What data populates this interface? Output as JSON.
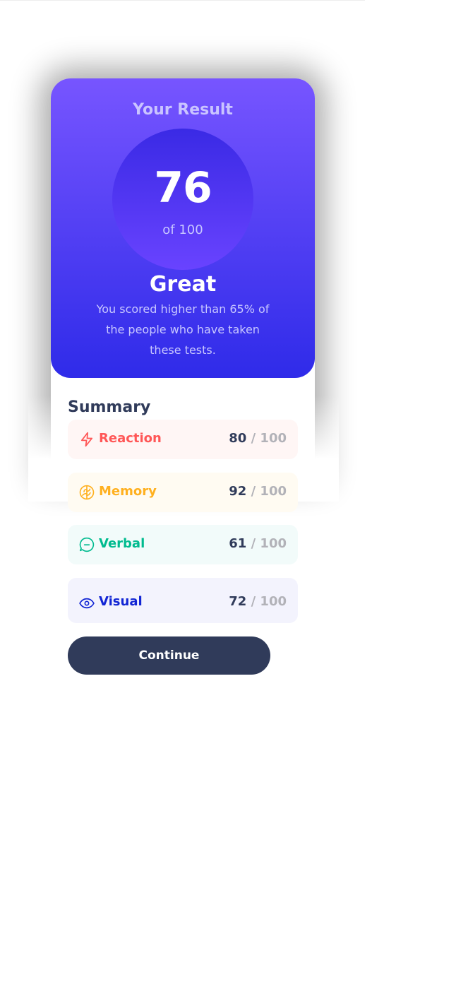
{
  "result": {
    "title": "Your Result",
    "score": "76",
    "of": "of 100",
    "rating": "Great",
    "description": "You scored higher than 65% of the people who have taken these tests."
  },
  "summary": {
    "title": "Summary",
    "items": [
      {
        "label": "Reaction",
        "score": "80",
        "separator": "/",
        "max": "100",
        "icon": "lightning-icon",
        "color": "#ff5757",
        "bg": "#fff6f5"
      },
      {
        "label": "Memory",
        "score": "92",
        "separator": "/",
        "max": "100",
        "icon": "brain-icon",
        "color": "#ffb01f",
        "bg": "#fffbf2"
      },
      {
        "label": "Verbal",
        "score": "61",
        "separator": "/",
        "max": "100",
        "icon": "chat-bubble-icon",
        "color": "#00bb8f",
        "bg": "#f2fbfa"
      },
      {
        "label": "Visual",
        "score": "72",
        "separator": "/",
        "max": "100",
        "icon": "eye-icon",
        "color": "#1125d4",
        "bg": "#f3f3fd"
      }
    ]
  },
  "continue_label": "Continue",
  "colors": {
    "gradient_top": "#7755ff",
    "gradient_bottom": "#2f2be9",
    "dark_text": "#303b5a",
    "muted_text": "#b2b2b8"
  }
}
